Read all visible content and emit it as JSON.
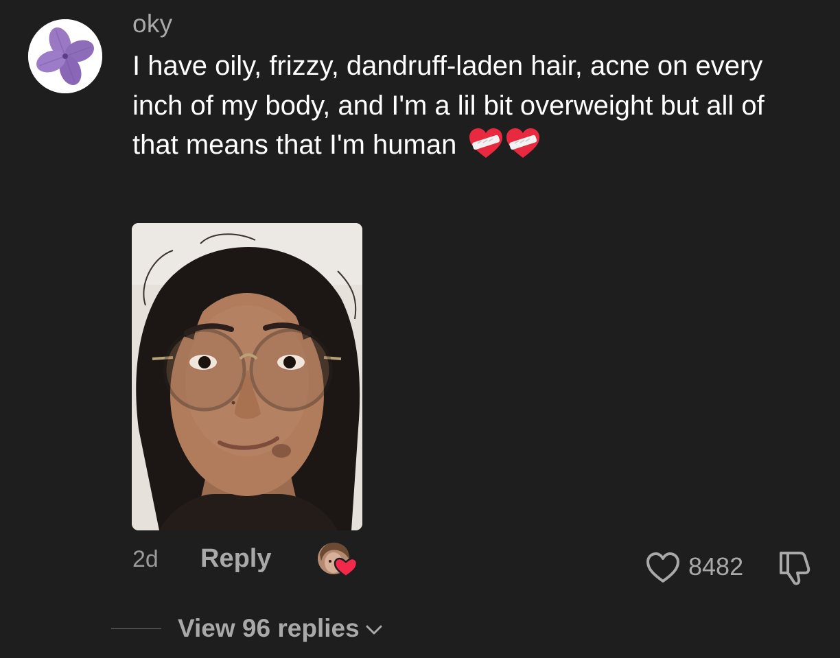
{
  "comment": {
    "username": "oky",
    "text": "I have oily, frizzy, dandruff-laden hair, acne on every inch of my body, and I'm a lil bit overweight but all of that means that I'm human",
    "emoji": [
      "mending-heart-icon",
      "mending-heart-icon"
    ],
    "avatar_icon": "purple-flower-icon",
    "photo_icon": "selfie-photo",
    "time": "2d",
    "reply_label": "Reply",
    "creator_liked": true,
    "like_count": "8482",
    "view_replies_label": "View 96 replies"
  },
  "colors": {
    "background": "#1e1e1e",
    "text_primary": "#ffffff",
    "text_secondary": "#a9a9a9",
    "heart_red": "#e8293f"
  }
}
